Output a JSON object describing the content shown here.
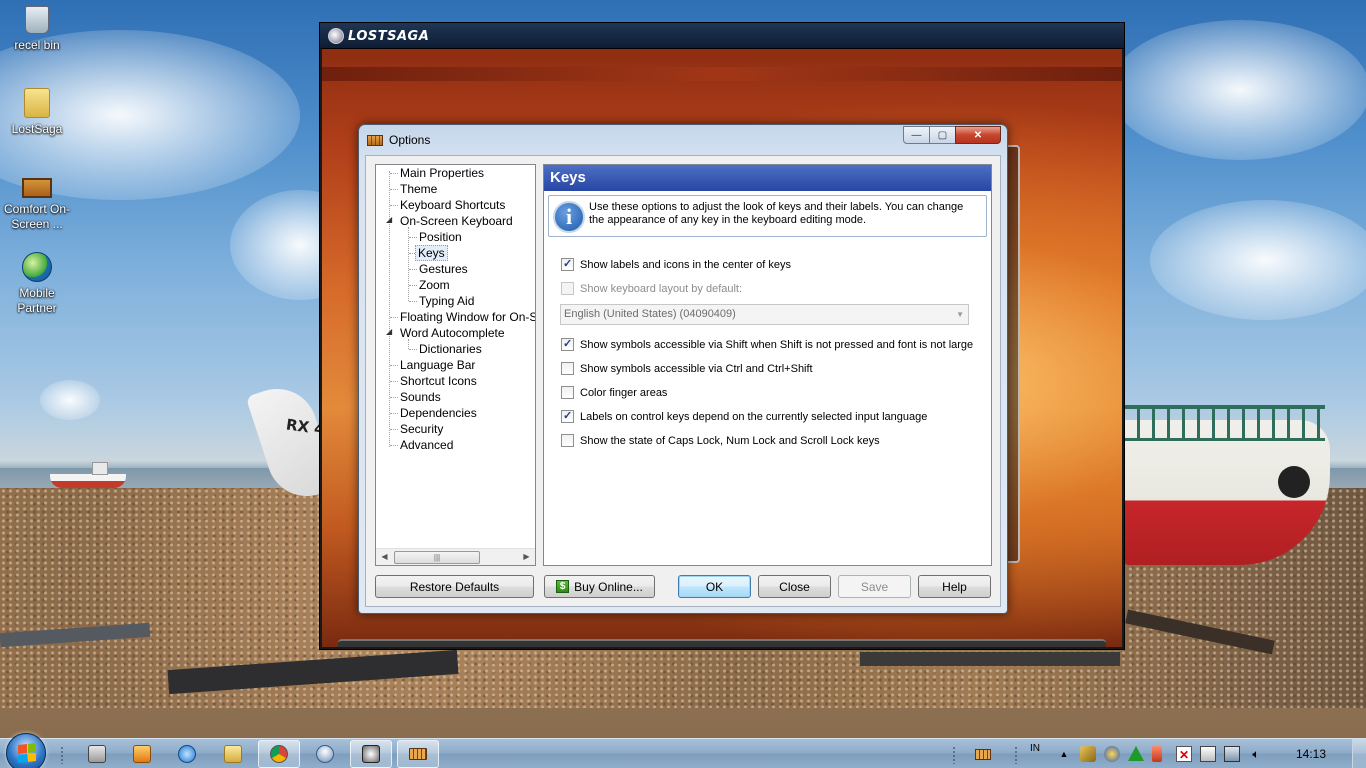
{
  "desktop": {
    "icons": [
      {
        "label": "recel bin",
        "icon": "recycle-bin-icon"
      },
      {
        "label": "LostSaga",
        "icon": "folder-icon"
      },
      {
        "label": "Comfort On-Screen ...",
        "icon": "keyboard-icon"
      },
      {
        "label": "Mobile Partner",
        "icon": "mobile-partner-icon"
      }
    ],
    "boat_text": "RX 4"
  },
  "game_window": {
    "title": "LOSTSAGA"
  },
  "dialog": {
    "title": "Options",
    "caption_buttons": {
      "minimize": "—",
      "maximize": "▢",
      "close": "✕"
    },
    "tree": [
      {
        "label": "Main Properties",
        "level": 0,
        "expander": ""
      },
      {
        "label": "Theme",
        "level": 0,
        "expander": ""
      },
      {
        "label": "Keyboard Shortcuts",
        "level": 0,
        "expander": ""
      },
      {
        "label": "On-Screen Keyboard",
        "level": 0,
        "expander": "◢"
      },
      {
        "label": "Position",
        "level": 1,
        "expander": ""
      },
      {
        "label": "Keys",
        "level": 1,
        "expander": "",
        "selected": true
      },
      {
        "label": "Gestures",
        "level": 1,
        "expander": ""
      },
      {
        "label": "Zoom",
        "level": 1,
        "expander": ""
      },
      {
        "label": "Typing Aid",
        "level": 1,
        "expander": ""
      },
      {
        "label": "Floating Window for On-Scre",
        "level": 0,
        "expander": ""
      },
      {
        "label": "Word Autocomplete",
        "level": 0,
        "expander": "◢"
      },
      {
        "label": "Dictionaries",
        "level": 1,
        "expander": ""
      },
      {
        "label": "Language Bar",
        "level": 0,
        "expander": ""
      },
      {
        "label": "Shortcut Icons",
        "level": 0,
        "expander": ""
      },
      {
        "label": "Sounds",
        "level": 0,
        "expander": ""
      },
      {
        "label": "Dependencies",
        "level": 0,
        "expander": ""
      },
      {
        "label": "Security",
        "level": 0,
        "expander": ""
      },
      {
        "label": "Advanced",
        "level": 0,
        "expander": ""
      }
    ],
    "scrollbar": {
      "left": "◀",
      "right": "▶",
      "thumb": "|||"
    },
    "panel": {
      "heading": "Keys",
      "info_icon": "i",
      "info_text": "Use these options to adjust the look of keys and their labels. You can change the appearance of any key in the keyboard editing mode.",
      "options": [
        {
          "label": "Show labels and icons in the center of keys",
          "checked": true,
          "disabled": false
        },
        {
          "label": "Show keyboard layout by default:",
          "checked": false,
          "disabled": true
        },
        {
          "label": "Show symbols accessible via Shift when Shift is not pressed and font is not large",
          "checked": true,
          "disabled": false
        },
        {
          "label": "Show symbols accessible via Ctrl and Ctrl+Shift",
          "checked": false,
          "disabled": false
        },
        {
          "label": "Color finger areas",
          "checked": false,
          "disabled": false
        },
        {
          "label": "Labels on control keys depend on the currently selected input language",
          "checked": true,
          "disabled": false
        },
        {
          "label": "Show the state of Caps Lock, Num Lock and Scroll Lock keys",
          "checked": false,
          "disabled": false
        }
      ],
      "layout_select": {
        "value": "English (United States) (04090409)",
        "arrow": "▼"
      }
    },
    "buttons": {
      "restore": "Restore Defaults",
      "buy": "Buy Online...",
      "buy_icon": "$",
      "ok": "OK",
      "close": "Close",
      "save": "Save",
      "help": "Help"
    }
  },
  "taskbar": {
    "language": "IN",
    "clock": "14:13",
    "tray_up_arrow": "▲"
  },
  "colors": {
    "panel_header": "#2846a4",
    "dialog_frame": "#c5d6ea",
    "close_button": "#c8452c"
  }
}
